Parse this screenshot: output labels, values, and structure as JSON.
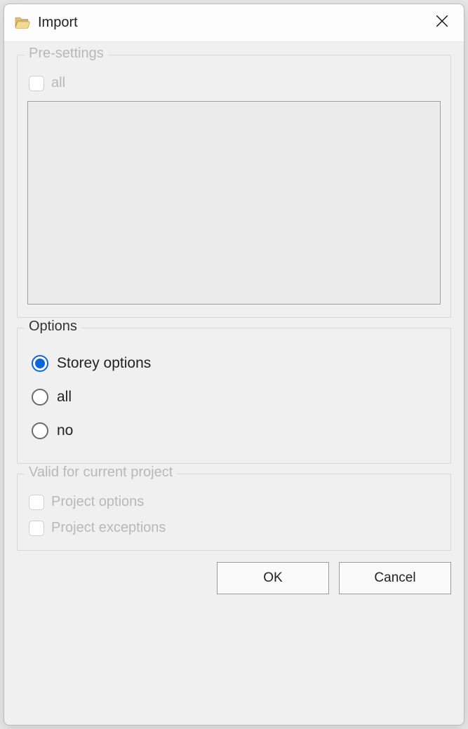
{
  "titlebar": {
    "title": "Import"
  },
  "pre_settings": {
    "legend": "Pre-settings",
    "all_label": "all"
  },
  "options": {
    "legend": "Options",
    "items": [
      {
        "label": "Storey options",
        "selected": true
      },
      {
        "label": "all",
        "selected": false
      },
      {
        "label": "no",
        "selected": false
      }
    ]
  },
  "valid": {
    "legend": "Valid for current project",
    "project_options_label": "Project options",
    "project_exceptions_label": "Project exceptions"
  },
  "buttons": {
    "ok": "OK",
    "cancel": "Cancel"
  }
}
